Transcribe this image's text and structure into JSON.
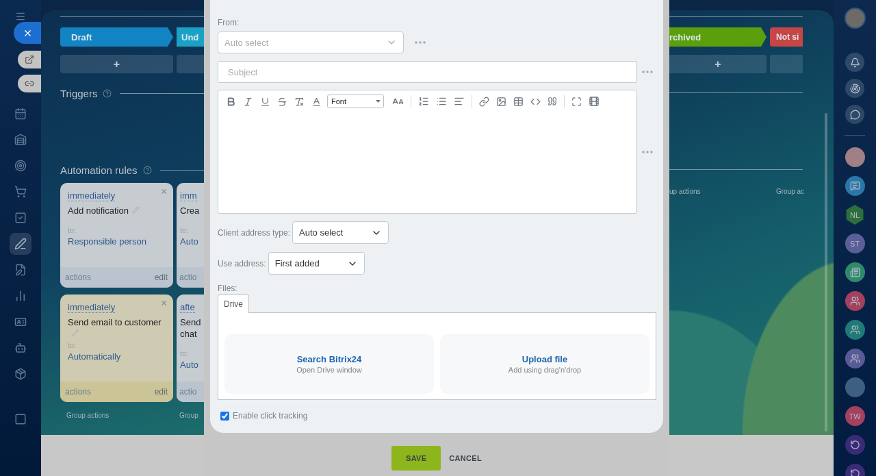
{
  "left_nav": {
    "items": [
      {
        "selected": false
      },
      {
        "selected": false
      },
      {
        "selected": false
      },
      {
        "selected": false
      },
      {
        "selected": false
      },
      {
        "selected": true
      },
      {
        "selected": false
      },
      {
        "selected": false
      },
      {
        "selected": false
      },
      {
        "selected": false
      },
      {
        "selected": false
      },
      {
        "selected": false
      }
    ]
  },
  "board": {
    "left": {
      "stages": [
        {
          "label": "Draft",
          "color": "#1284c4",
          "add_label": "+"
        },
        {
          "label": "Und",
          "color": "#1aa2c6"
        }
      ],
      "triggers_title": "Triggers",
      "rules_title": "Automation rules",
      "rule_columns": [
        {
          "cards": [
            {
              "timing": "immediately",
              "title": "Add notification",
              "to_label": "to:",
              "target": "Responsible person",
              "footer_left": "actions",
              "footer_right": "edit",
              "color": "#c7ccd1"
            },
            {
              "timing": "immediately",
              "title": "Send email to customer",
              "to_label": "to:",
              "target": "Automatically",
              "footer_left": "actions",
              "footer_right": "edit",
              "color": "#cfcbb2"
            }
          ],
          "group_actions": "Group actions"
        },
        {
          "cards": [
            {
              "timing": "imm",
              "title": "Crea",
              "to_label": "to:",
              "target": "Auto",
              "footer_left": "actio",
              "color": "#c7ccd1"
            },
            {
              "timing": "afte",
              "title": "Send chat",
              "to_label": "to:",
              "target": "Auto",
              "footer_left": "actio",
              "color": "#c7ccd1"
            }
          ],
          "group_actions": "Group"
        }
      ]
    },
    "right": {
      "stages": [
        {
          "label": "rchived",
          "color": "#5c9f0c",
          "add_label": "+"
        },
        {
          "label": "Not si",
          "color": "#c84545"
        }
      ],
      "group_actions": [
        "up actions",
        "Group ac"
      ]
    }
  },
  "dialog": {
    "from": {
      "label": "From:",
      "placeholder": "Auto select"
    },
    "subject": {
      "placeholder": "Subject"
    },
    "editor": {
      "font": "Font"
    },
    "client_address_type": {
      "label": "Client address type:",
      "value": "Auto select"
    },
    "use_address": {
      "label": "Use address:",
      "value": "First added"
    },
    "files": {
      "label": "Files:",
      "tabs": [
        {
          "label": "Drive",
          "selected": true
        }
      ],
      "options": [
        {
          "title": "Search Bitrix24",
          "subtitle": "Open Drive window"
        },
        {
          "title": "Upload file",
          "subtitle": "Add using drag'n'drop"
        }
      ]
    },
    "click_tracking": {
      "label": "Enable click tracking",
      "checked": true
    },
    "buttons": [
      {
        "label": "SAVE",
        "kind": "primary"
      },
      {
        "label": "CANCEL",
        "kind": "link"
      }
    ]
  },
  "right_nav": {
    "items": [
      {
        "kind": "photo",
        "color": "#a07f86"
      },
      {
        "kind": "chat",
        "color": "#2a77a8"
      },
      {
        "kind": "hex",
        "text": "NL",
        "color": "#2d6f3a"
      },
      {
        "kind": "initials",
        "text": "ST",
        "color": "#5a5f98"
      },
      {
        "kind": "news",
        "color": "#2f8a6a"
      },
      {
        "kind": "group",
        "color": "#a3415f"
      },
      {
        "kind": "group",
        "color": "#1f7a78"
      },
      {
        "kind": "group",
        "color": "#5a5a96"
      },
      {
        "kind": "photo",
        "color": "#3d5f80"
      },
      {
        "kind": "initials",
        "text": "TW",
        "color": "#a3415f"
      },
      {
        "kind": "ring",
        "color": "#3b2a78"
      },
      {
        "kind": "ring",
        "color": "#3b2a78"
      }
    ]
  }
}
